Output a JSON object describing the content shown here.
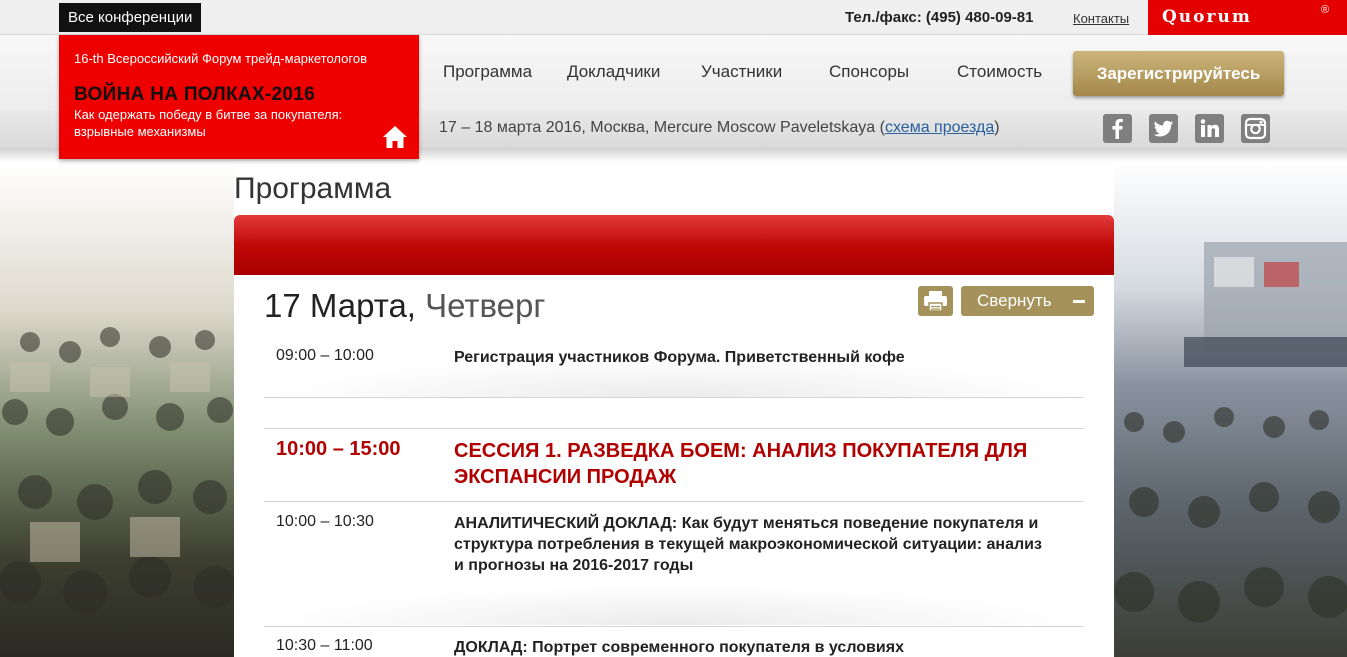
{
  "topbar": {
    "all_conferences": "Все конференции",
    "phone": "Тел./факс: (495) 480-09-81",
    "contacts": "Контакты",
    "brand": "Quorum",
    "brand_mark": "®"
  },
  "event": {
    "subtitle": "16-th Всероссийский Форум трейд-маркетологов",
    "title": "ВОЙНА НА ПОЛКАХ-2016",
    "tagline": "Как одержать победу в битве за покупателя: взрывные механизмы",
    "dates": "17 – 18 марта 2016, Москва, Mercure Moscow Paveletskaya",
    "paren_open": "(",
    "map_link": "схема проезда",
    "paren_close": ")"
  },
  "nav": {
    "items": [
      "Программа",
      "Докладчики",
      "Участники",
      "Спонсоры",
      "Стоимость"
    ],
    "register": "Зарегистрируйтесь"
  },
  "social": [
    "facebook-icon",
    "twitter-icon",
    "linkedin-icon",
    "instagram-icon"
  ],
  "program": {
    "page_title": "Программа",
    "day": {
      "date": "17 Марта,",
      "weekday": "Четверг"
    },
    "collapse_label": "Свернуть",
    "rows": [
      {
        "time": "09:00 – 10:00",
        "text": "Регистрация участников Форума. Приветственный кофе"
      },
      {
        "time": "10:00 – 15:00",
        "text": "СЕССИЯ 1. РАЗВЕДКА БОЕМ: АНАЛИЗ ПОКУПАТЕЛЯ ДЛЯ ЭКСПАНСИИ ПРОДАЖ"
      },
      {
        "time": "10:00 – 10:30",
        "label": "АНАЛИТИЧЕСКИЙ ДОКЛАД:",
        "text": "Как будут меняться поведение покупателя и структура потребления в текущей макроэкономической ситуации: анализ и прогнозы на 2016-2017 годы"
      },
      {
        "time": "10:30 – 11:00",
        "label": "ДОКЛАД:",
        "text": "Портрет современного покупателя в условиях"
      }
    ]
  },
  "colors": {
    "brand_red": "#ee0000",
    "accent_gold": "#a5915a",
    "session_red": "#b00000"
  }
}
